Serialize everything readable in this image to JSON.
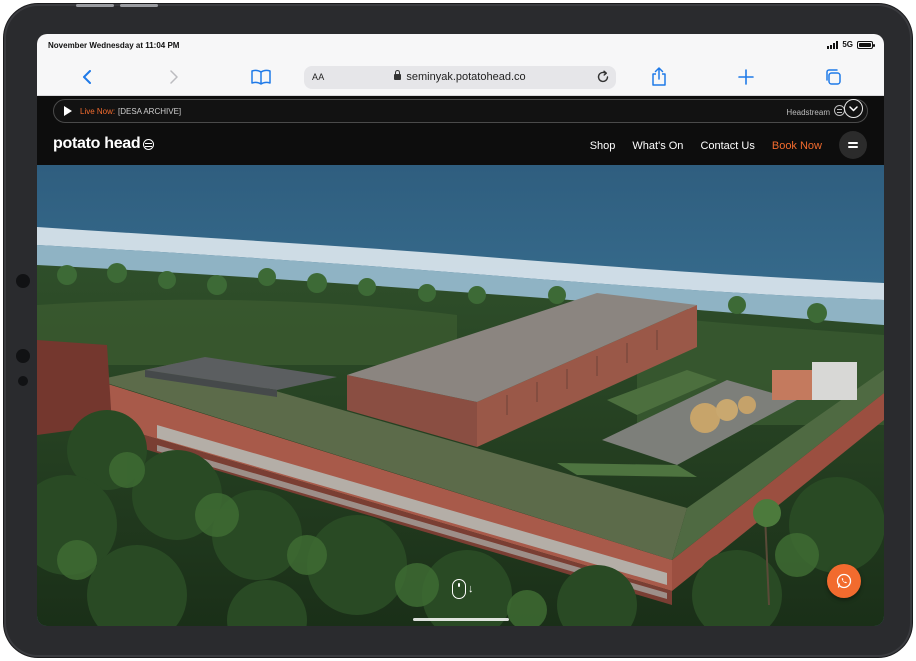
{
  "status_bar": {
    "time": "November Wednesday at 11:04 PM",
    "network": "5G",
    "battery_level": 1.0
  },
  "browser": {
    "text_size_label": "AA",
    "url": "seminyak.potatohead.co",
    "icons": [
      "back-icon",
      "forward-icon",
      "bookmarks-icon",
      "lock-icon",
      "reload-icon",
      "share-icon",
      "new-tab-icon",
      "tabs-icon"
    ]
  },
  "live_bar": {
    "live_label": "Live Now:",
    "title": "[DESA ARCHIVE]",
    "headstream_label": "Headstream"
  },
  "navbar": {
    "brand": "potato head",
    "links": [
      "Shop",
      "What's On",
      "Contact Us"
    ],
    "book_now": "Book Now"
  },
  "colors": {
    "accent": "#f26b2e",
    "browser_blue": "#1f7ae8",
    "page_bg": "#0d0d0d"
  },
  "hero": {
    "image_icon": "aerial-resort-photo",
    "scroll_icon": "mouse-scroll-icon",
    "chat_icon": "whatsapp-icon"
  }
}
